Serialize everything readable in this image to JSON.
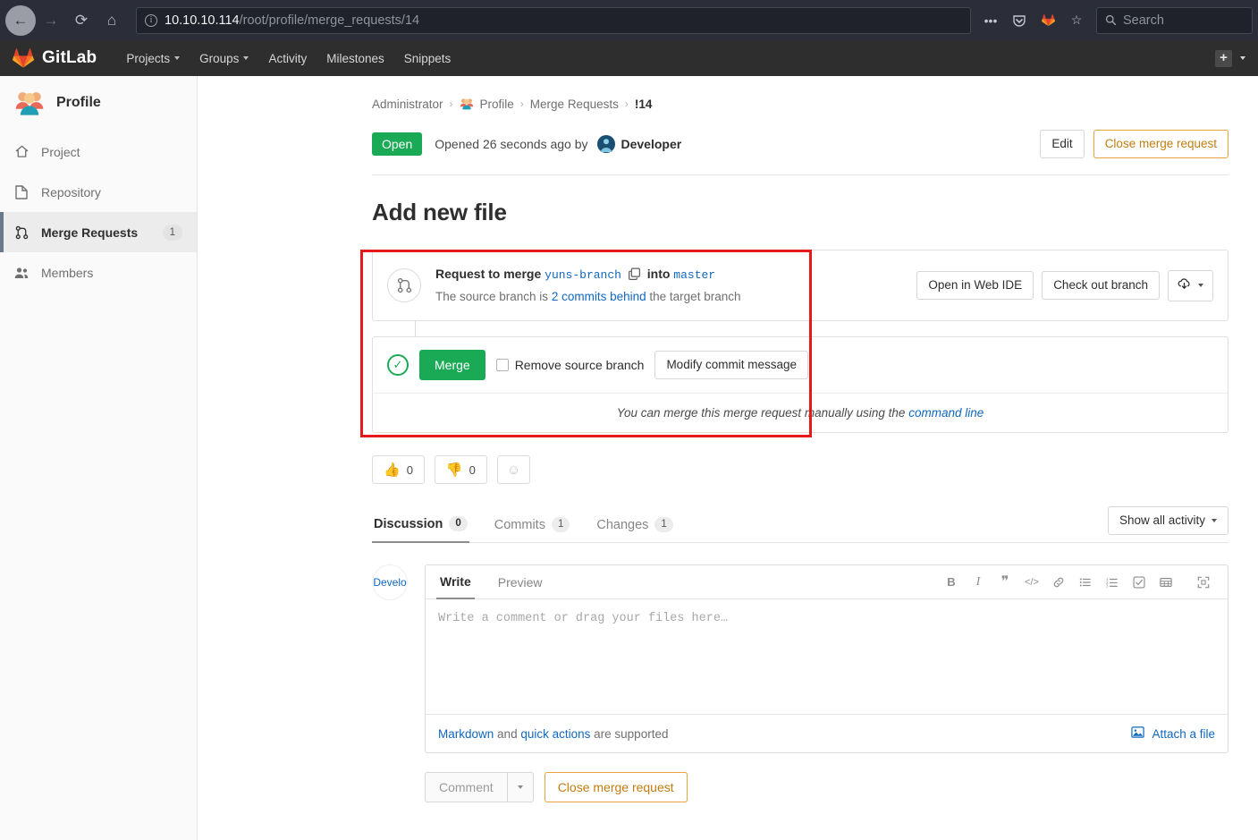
{
  "browser": {
    "back_icon": "back-arrow-icon",
    "forward_icon": "forward-arrow-icon",
    "reload_icon": "reload-icon",
    "home_icon": "home-icon",
    "url_host": "10.10.10.114",
    "url_path": "/root/profile/merge_requests/14",
    "search_placeholder": "Search",
    "icons": [
      "more-icon",
      "pocket-icon",
      "gitlab-icon",
      "bookmark-star-icon"
    ]
  },
  "gitlab_nav": {
    "brand": "GitLab",
    "items": [
      {
        "label": "Projects",
        "has_caret": true
      },
      {
        "label": "Groups",
        "has_caret": true
      },
      {
        "label": "Activity",
        "has_caret": false
      },
      {
        "label": "Milestones",
        "has_caret": false
      },
      {
        "label": "Snippets",
        "has_caret": false
      }
    ],
    "plus_label": "+"
  },
  "sidebar": {
    "project_name": "Profile",
    "items": [
      {
        "label": "Project",
        "icon": "home-icon",
        "badge": "",
        "active": false
      },
      {
        "label": "Repository",
        "icon": "document-icon",
        "badge": "",
        "active": false
      },
      {
        "label": "Merge Requests",
        "icon": "merge-request-icon",
        "badge": "1",
        "active": true
      },
      {
        "label": "Members",
        "icon": "people-icon",
        "badge": "",
        "active": false
      }
    ]
  },
  "breadcrumb": {
    "root": "Administrator",
    "project": "Profile",
    "section": "Merge Requests",
    "current": "!14",
    "separator": "›"
  },
  "status": {
    "badge": "Open",
    "opened_text": "Opened 26 seconds ago by",
    "author": "Developer",
    "edit_label": "Edit",
    "close_label": "Close merge request"
  },
  "mr": {
    "title": "Add new file"
  },
  "merge_widget": {
    "request_prefix": "Request to merge",
    "source_branch": "yuns-branch",
    "copy_icon": "copy-icon",
    "into_word": "into",
    "target_branch": "master",
    "behind_prefix": "The source branch is",
    "behind_link": "2 commits behind",
    "behind_suffix": "the target branch",
    "web_ide_label": "Open in Web IDE",
    "checkout_label": "Check out branch",
    "download_icon": "download-code-icon",
    "merge_label": "Merge",
    "remove_branch_label": "Remove source branch",
    "remove_branch_checked": false,
    "modify_commit_label": "Modify commit message",
    "manual_text": "You can merge this merge request manually using the",
    "manual_link": "command line"
  },
  "awards": [
    {
      "emoji": "👍",
      "count": "0",
      "name": "thumbsup-award"
    },
    {
      "emoji": "👎",
      "count": "0",
      "name": "thumbsdown-award"
    }
  ],
  "add_award_icon": "smiley-icon",
  "tabs": [
    {
      "label": "Discussion",
      "count": "0",
      "active": true
    },
    {
      "label": "Commits",
      "count": "1",
      "active": false
    },
    {
      "label": "Changes",
      "count": "1",
      "active": false
    }
  ],
  "show_activity_label": "Show all activity",
  "comment": {
    "avatar_alt": "Develo",
    "write_tab": "Write",
    "preview_tab": "Preview",
    "placeholder": "Write a comment or drag your files here…",
    "value": "",
    "toolbar": [
      {
        "glyph": "B",
        "name": "bold-icon"
      },
      {
        "glyph": "I",
        "name": "italic-icon"
      },
      {
        "glyph": "❞",
        "name": "quote-icon"
      },
      {
        "glyph": "</>",
        "name": "code-icon"
      },
      {
        "glyph": "🔗",
        "name": "link-icon"
      },
      {
        "glyph": "☰",
        "name": "bulleted-list-icon"
      },
      {
        "glyph": "⒈",
        "name": "numbered-list-icon"
      },
      {
        "glyph": "☑",
        "name": "task-list-icon"
      },
      {
        "glyph": "▤",
        "name": "table-icon"
      },
      {
        "glyph": "⛶",
        "name": "fullscreen-icon"
      }
    ],
    "footer_md": "Markdown",
    "footer_and": "and",
    "footer_qa": "quick actions",
    "footer_tail": "are supported",
    "attach_label": "Attach a file",
    "comment_label": "Comment",
    "close_mr_label": "Close merge request"
  },
  "colors": {
    "green": "#1aaa55",
    "orange": "#c17d10",
    "link_blue": "#1068bf",
    "annotation_red": "#e51b1b"
  }
}
